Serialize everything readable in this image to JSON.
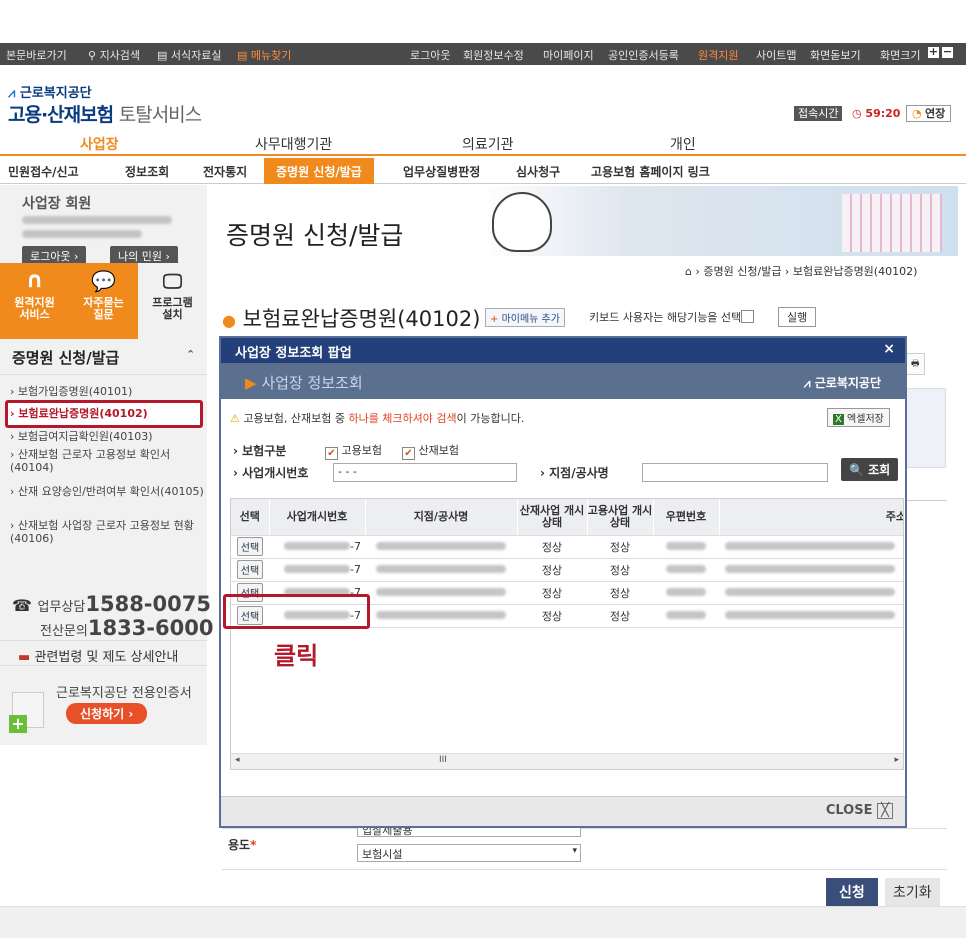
{
  "topbar": {
    "items": [
      "본문바로가기",
      "지사검색",
      "서식자료실",
      "메뉴찾기",
      "로그아웃",
      "회원정보수정",
      "마이페이지",
      "공인인증서등록",
      "원격지원",
      "사이트맵",
      "화면돋보기",
      "화면크기"
    ],
    "accent": "#ff8a3d"
  },
  "logo": {
    "org": "근로복지공단",
    "service_bold": "고용·산재보험",
    "service_light": "토탈서비스"
  },
  "session": {
    "label": "접속시간",
    "time": "59:20",
    "extend": "연장"
  },
  "main_nav": [
    "사업장",
    "사무대행기관",
    "의료기관",
    "개인"
  ],
  "sub_nav": [
    "민원접수/신고",
    "정보조회",
    "전자통지",
    "증명원 신청/발급",
    "업무상질병판정",
    "심사청구",
    "고용보험 홈페이지 링크"
  ],
  "sidebar": {
    "member_title": "사업장 회원",
    "logout": "로그아웃",
    "my_request": "나의 민원",
    "quick": [
      {
        "label": "원격지원 서비스",
        "icon": "headset-icon"
      },
      {
        "label": "자주묻는 질문",
        "icon": "chat-bubble-icon"
      },
      {
        "label": "프로그램 설치",
        "icon": "monitor-icon"
      }
    ],
    "menu_title": "증명원 신청/발급",
    "menu": [
      "보험가입증명원(40101)",
      "보험료완납증명원(40102)",
      "보험급여지급확인원(40103)",
      "산재보험 근로자 고용정보 확인서(40104)",
      "산재 요양승인/반려여부 확인서(40105)",
      "산재보험 사업장 근로자 고용정보 현황(40106)"
    ],
    "phone1_label": "업무상담",
    "phone1": "1588-0075",
    "phone2_label": "전산문의",
    "phone2": "1833-6000",
    "law_link": "관련법령 및 제도 상세안내",
    "cert_title": "근로복지공단 전용인증서",
    "cert_btn": "신청하기"
  },
  "page": {
    "banner_title": "증명원 신청/발급",
    "breadcrumb": [
      "증명원 신청/발급",
      "보험료완납증명원(40102)"
    ],
    "title": "보험료완납증명원(40102)",
    "add_menu": "마이메뉴 추가",
    "keyboard_note": "키보드 사용자는 해당기능을 선택",
    "run": "실행",
    "purpose_label": "용도",
    "purpose_values": [
      "입찰제출용",
      "보험시설"
    ],
    "apply": "신청",
    "reset": "초기화"
  },
  "popup": {
    "title": "사업장 정보조회 팝업",
    "header": "사업장 정보조회",
    "org": "근로복지공단",
    "notice_pre": "고용보험, 산재보험 중 ",
    "notice_hl": "하나를 체크하셔야 검색",
    "notice_post": "이 가능합니다.",
    "excel": "엑셀저장",
    "ins_type_label": "보험구분",
    "ins_employment": "고용보험",
    "ins_industrial": "산재보험",
    "reg_no_label": "사업개시번호",
    "reg_no_value": "-  -  -",
    "branch_label": "지점/공사명",
    "search": "조회",
    "columns": [
      "선택",
      "사업개시번호",
      "지점/공사명",
      "산재사업 개시상태",
      "고용사업 개시상태",
      "우편번호",
      "주소"
    ],
    "rows": [
      {
        "select": "선택",
        "no_suffix": "-7",
        "sanjae": "정상",
        "goyong": "정상"
      },
      {
        "select": "선택",
        "no_suffix": "-7",
        "sanjae": "정상",
        "goyong": "정상"
      },
      {
        "select": "선택",
        "no_suffix": "-7",
        "sanjae": "정상",
        "goyong": "정상"
      },
      {
        "select": "선택",
        "no_suffix": "-7",
        "sanjae": "정상",
        "goyong": "정상"
      }
    ],
    "scroll_mid": "III",
    "close": "CLOSE"
  },
  "annotation": {
    "click": "클릭",
    "color": "#b4182a"
  }
}
